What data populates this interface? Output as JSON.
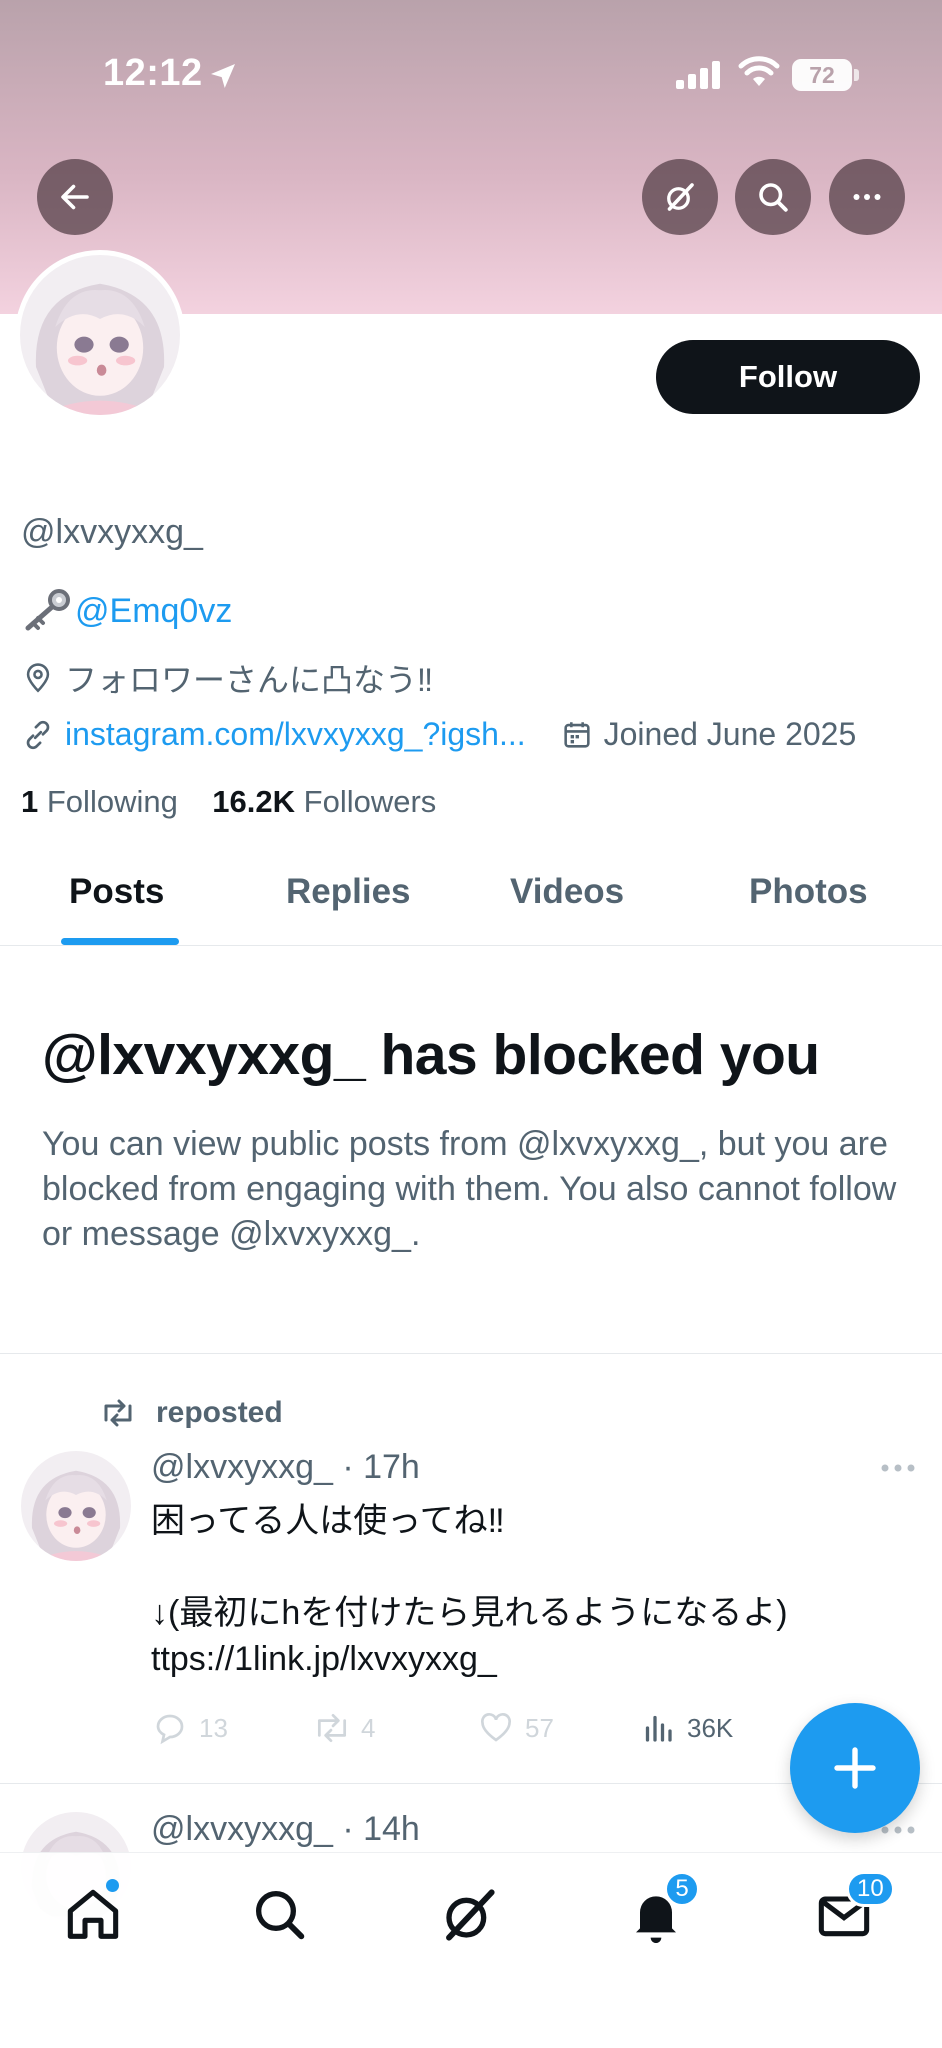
{
  "status_bar": {
    "time": "12:12",
    "battery": "72"
  },
  "profile": {
    "follow_label": "Follow",
    "handle": "@lxvxyxxg_",
    "bio_mention": "@Emq0vz",
    "location": "フォロワーさんに凸なう‼︎",
    "website": "instagram.com/lxvxyxxg_?igsh...",
    "joined": "Joined June 2025",
    "following_count": "1",
    "following_label": "Following",
    "followers_count": "16.2K",
    "followers_label": "Followers"
  },
  "tabs": [
    "Posts",
    "Replies",
    "Videos",
    "Photos"
  ],
  "blocked": {
    "title": "@lxvxyxxg_ has blocked you",
    "text": "You can view public posts from @lxvxyxxg_, but you are blocked from engaging with them. You also cannot follow or message @lxvxyxxg_."
  },
  "posts": [
    {
      "repost_label": "reposted",
      "author": "@lxvxyxxg_",
      "time": "17h",
      "text": "困ってる人は使ってね‼︎\n\n↓(最初にhを付けたら見れるようになるよ)\nttps://1link.jp/lxvxyxxg_",
      "replies": "13",
      "reposts": "4",
      "likes": "57",
      "views": "36K"
    },
    {
      "author": "@lxvxyxxg_",
      "time": "14h"
    }
  ],
  "bottom_nav": {
    "notifications_badge": "5",
    "messages_badge": "10"
  },
  "colors": {
    "accent": "#1d9bf0",
    "text": "#0f1419",
    "muted": "#536471",
    "banner": "#f3d2df"
  },
  "icons": [
    "back-arrow-icon",
    "grok-icon",
    "search-icon",
    "more-icon",
    "key-emoji-icon",
    "location-pin-icon",
    "link-icon",
    "calendar-icon",
    "repost-icon",
    "reply-icon",
    "like-icon",
    "views-icon",
    "plus-icon",
    "home-icon",
    "bell-icon",
    "mail-icon"
  ]
}
